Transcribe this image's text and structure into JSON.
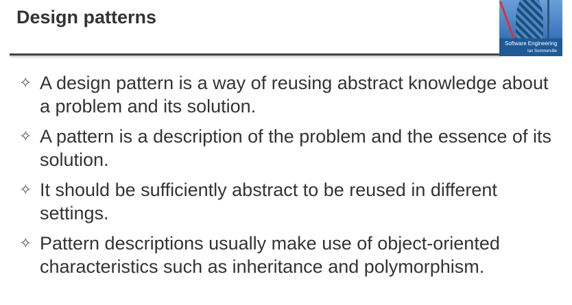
{
  "title": "Design patterns",
  "cover": {
    "title": "Software Engineering",
    "author": "Ian Sommerville"
  },
  "bullet_icon": "four-pointed-star-outline",
  "bullets": [
    "A design pattern is a way of reusing abstract knowledge about a problem and its solution.",
    "A pattern is a description of the problem and the essence of its solution.",
    "It should be sufficiently abstract to be reused in different settings.",
    "Pattern descriptions usually make use of object-oriented characteristics such as inheritance and polymorphism."
  ]
}
